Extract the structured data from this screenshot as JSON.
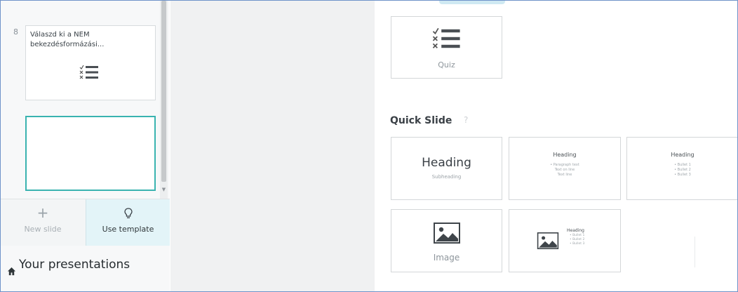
{
  "sidebar": {
    "slides": [
      {
        "number": "8",
        "title": "Válaszd ki a NEM bekezdésformázási...",
        "icon": "quiz-list-icon"
      },
      {
        "number": "",
        "title": "",
        "icon": ""
      }
    ],
    "actions": {
      "new_slide": {
        "label": "New slide",
        "icon": "plus-icon"
      },
      "use_template": {
        "label": "Use template",
        "icon": "lightbulb-icon"
      }
    },
    "your_presentations": {
      "label": "Your presentations",
      "icon": "home-icon"
    }
  },
  "panel": {
    "quiz_card": {
      "label": "Quiz",
      "icon": "quiz-list-icon"
    },
    "quick_slide": {
      "title": "Quick Slide",
      "help": "?",
      "layouts": [
        {
          "heading": "Heading",
          "subheading": "Subheading"
        },
        {
          "heading": "Heading",
          "lines": [
            "• Paragraph text",
            "Text on line",
            "Text line"
          ]
        },
        {
          "heading": "Heading",
          "lines": [
            "• Bullet 1",
            "• Bullet 2",
            "• Bullet 3"
          ]
        },
        {
          "label": "Image",
          "icon": "image-icon"
        },
        {
          "heading": "Heading",
          "lines": [
            "• Bullet 1",
            "• Bullet 2",
            "• Bullet 3"
          ],
          "icon": "image-icon"
        }
      ]
    }
  },
  "colors": {
    "accent_teal": "#3ab3b0",
    "template_bg": "#e3f4f8",
    "canvas_gray": "#f0f1f2",
    "frame_border": "#6f93c9"
  }
}
